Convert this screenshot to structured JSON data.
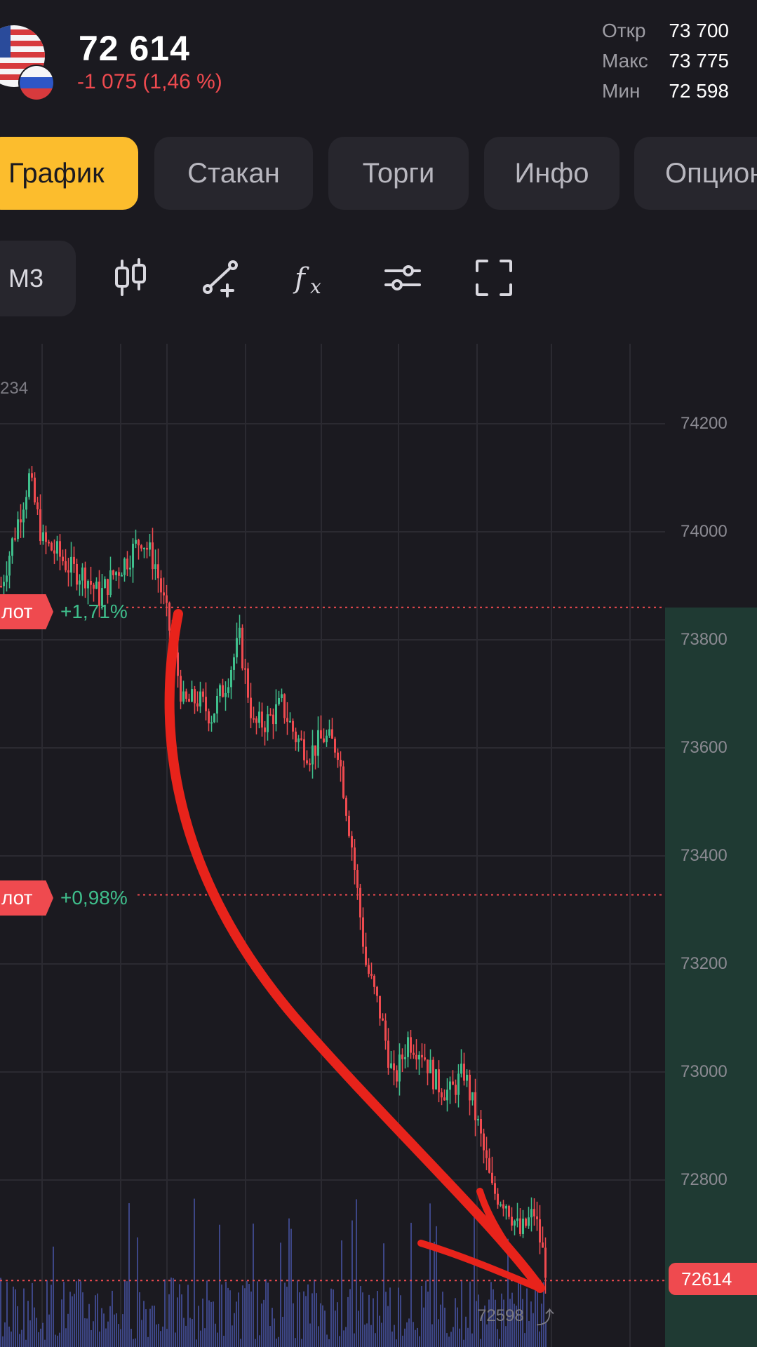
{
  "header": {
    "price": "72 614",
    "change": "-1 075 (1,46 %)",
    "stats": [
      {
        "label": "Откр",
        "value": "73 700"
      },
      {
        "label": "Макс",
        "value": "73 775"
      },
      {
        "label": "Мин",
        "value": "72 598"
      }
    ]
  },
  "tabs": [
    {
      "label": "График",
      "active": true
    },
    {
      "label": "Стакан",
      "active": false
    },
    {
      "label": "Торги",
      "active": false
    },
    {
      "label": "Инфо",
      "active": false
    },
    {
      "label": "Опционы",
      "active": false
    }
  ],
  "toolbar": {
    "interval": "М3",
    "icons": [
      "candlestick-icon",
      "draw-line-icon",
      "indicators-fx-icon",
      "settings-sliders-icon",
      "fullscreen-icon"
    ]
  },
  "chart": {
    "top_left_label": "234",
    "y_ticks": [
      "74200",
      "74000",
      "73800",
      "73600",
      "73400",
      "73200",
      "73000",
      "72800"
    ],
    "orders": [
      {
        "label": "лот",
        "pct": "+1,71%",
        "price": 73860
      },
      {
        "label": "лот",
        "pct": "+0,98%",
        "price": 73328
      }
    ],
    "current_price": "72614",
    "min_label": "72598",
    "min_arrow": "⤴"
  },
  "colors": {
    "background": "#1b1a20",
    "accent": "#fcbd2d",
    "down": "#ef4a4f",
    "up": "#3fbf8c",
    "volume": "#4a55a8"
  },
  "chart_data": {
    "type": "candlestick",
    "ylim": [
      72500,
      74350
    ],
    "y_ticks": [
      74200,
      74000,
      73800,
      73600,
      73400,
      73200,
      73000,
      72800
    ],
    "x": [
      0,
      20,
      40,
      60,
      80,
      100,
      120,
      140,
      160,
      180,
      200,
      220,
      240,
      260,
      280,
      300,
      320,
      340,
      360,
      380,
      400,
      420,
      440,
      460,
      480,
      500,
      520,
      540,
      560,
      580,
      600,
      620,
      640,
      660,
      680,
      700,
      720,
      740,
      760,
      780
    ],
    "close": [
      73900,
      74000,
      74100,
      73980,
      73960,
      73930,
      73920,
      73880,
      73920,
      73950,
      73990,
      73940,
      73820,
      73680,
      73690,
      73660,
      73720,
      73800,
      73640,
      73650,
      73680,
      73620,
      73590,
      73620,
      73600,
      73420,
      73200,
      73110,
      72980,
      73060,
      73040,
      72980,
      72960,
      73000,
      72900,
      72780,
      72760,
      72700,
      72740,
      72614
    ],
    "current_price": 72614,
    "min_price": 72598,
    "order_levels": [
      73860,
      73328
    ]
  }
}
